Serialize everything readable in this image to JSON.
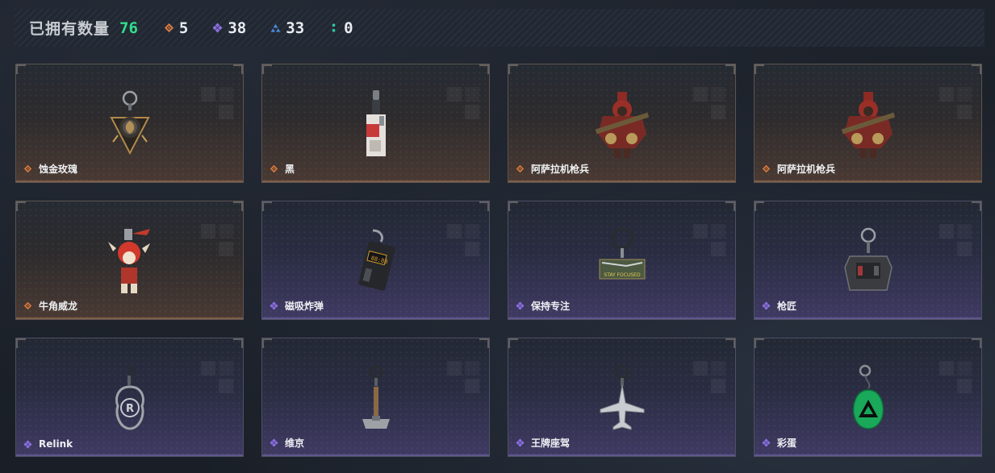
{
  "header": {
    "owned_label": "已拥有数量",
    "owned_count": "76",
    "stats": [
      {
        "icon": "orange-diamond-icon",
        "color": "#d67a3e",
        "value": "5"
      },
      {
        "icon": "purple-diamond-icon",
        "color": "#8b6ee0",
        "value": "38"
      },
      {
        "icon": "blue-triangle-icon",
        "color": "#4b8ce0",
        "value": "33"
      },
      {
        "icon": "teal-dots-icon",
        "color": "#2fc7a0",
        "value": "0"
      }
    ]
  },
  "items": [
    {
      "name": "蚀金玫瑰",
      "rarity": "orange",
      "icon": "gold-rose-charm-icon"
    },
    {
      "name": "黑",
      "rarity": "orange",
      "icon": "black-device-charm-icon"
    },
    {
      "name": "阿萨拉机枪兵",
      "rarity": "orange",
      "icon": "asala-gunner-charm-icon"
    },
    {
      "name": "阿萨拉机枪兵",
      "rarity": "orange",
      "icon": "asala-gunner-charm-icon"
    },
    {
      "name": "牛角威龙",
      "rarity": "orange",
      "icon": "horned-dragon-charm-icon"
    },
    {
      "name": "磁吸炸弹",
      "rarity": "purple",
      "icon": "magnetic-bomb-charm-icon"
    },
    {
      "name": "保持专注",
      "rarity": "purple",
      "icon": "stay-focused-charm-icon",
      "tag": "STAY FOCUSED"
    },
    {
      "name": "枪匠",
      "rarity": "purple",
      "icon": "gunsmith-charm-icon"
    },
    {
      "name": "Relink",
      "rarity": "purple",
      "icon": "relink-charm-icon"
    },
    {
      "name": "维京",
      "rarity": "purple",
      "icon": "viking-hammer-charm-icon"
    },
    {
      "name": "王牌座驾",
      "rarity": "purple",
      "icon": "ace-jet-charm-icon"
    },
    {
      "name": "彩蛋",
      "rarity": "purple",
      "icon": "easter-egg-charm-icon"
    }
  ],
  "colors": {
    "orange": "#d67a3e",
    "purple": "#8b6ee0",
    "owned_count": "#2fe08b"
  }
}
